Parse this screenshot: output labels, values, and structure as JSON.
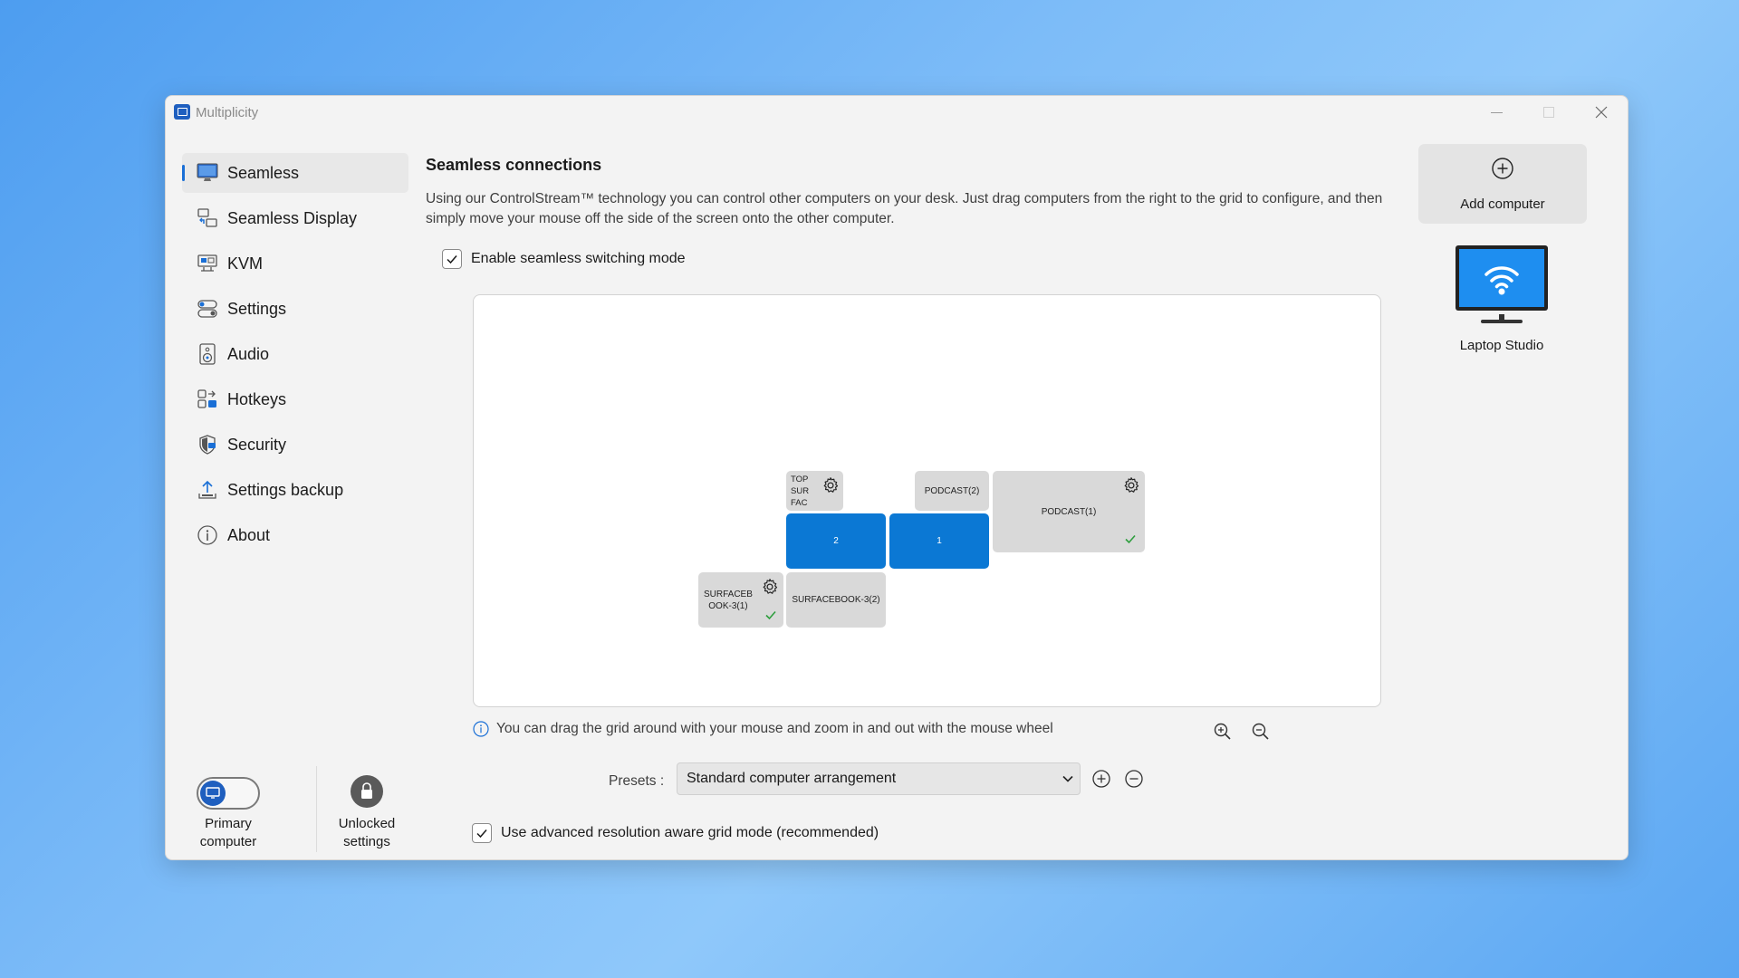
{
  "window": {
    "title": "Multiplicity"
  },
  "sidebar": {
    "items": [
      {
        "label": "Seamless",
        "icon": "monitor-icon",
        "active": true
      },
      {
        "label": "Seamless Display",
        "icon": "seamless-display-icon"
      },
      {
        "label": "KVM",
        "icon": "kvm-icon"
      },
      {
        "label": "Settings",
        "icon": "toggles-icon"
      },
      {
        "label": "Audio",
        "icon": "speaker-icon"
      },
      {
        "label": "Hotkeys",
        "icon": "hotkeys-icon"
      },
      {
        "label": "Security",
        "icon": "shield-icon"
      },
      {
        "label": "Settings backup",
        "icon": "upload-icon"
      },
      {
        "label": "About",
        "icon": "info-icon"
      }
    ],
    "primary_label_line1": "Primary",
    "primary_label_line2": "computer",
    "unlocked_label_line1": "Unlocked",
    "unlocked_label_line2": "settings"
  },
  "main": {
    "title": "Seamless connections",
    "description": "Using our ControlStream™ technology you can control other computers on your desk.  Just drag computers from the right to the grid to configure, and then simply move your mouse off the side of the screen onto the other computer.",
    "enable_label": "Enable seamless switching mode",
    "enable_checked": true,
    "hint": "You can drag the grid around with your mouse and zoom in and out with the mouse wheel",
    "presets_label": "Presets :",
    "preset_selected": "Standard computer arrangement",
    "advanced_label": "Use advanced resolution aware grid mode (recommended)",
    "advanced_checked": true
  },
  "grid": {
    "tiles": {
      "top_surface_line1": "TOP",
      "top_surface_line2": "SUR",
      "top_surface_line3": "FAC",
      "podcast2": "PODCAST(2)",
      "podcast1": "PODCAST(1)",
      "screen2": "2",
      "screen1": "1",
      "surfacebook31_line1": "SURFACEB",
      "surfacebook31_line2": "OOK-3(1)",
      "surfacebook32": "SURFACEBOOK-3(2)"
    }
  },
  "right_panel": {
    "add_label": "Add computer",
    "computer_label": "Laptop Studio"
  },
  "colors": {
    "accent": "#0b78d4",
    "check": "#2e9e3e"
  }
}
